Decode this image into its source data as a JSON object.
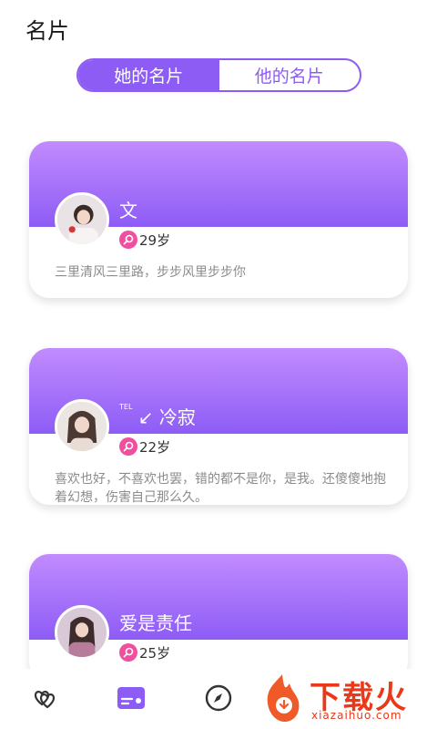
{
  "header": {
    "title": "名片"
  },
  "segments": {
    "left": "她的名片",
    "right": "他的名片"
  },
  "cards": [
    {
      "name": "文",
      "tel": "",
      "age": "29岁",
      "bio": "三里清风三里路，步步风里步步你"
    },
    {
      "name": "冷寂",
      "tel": "TEL",
      "age": "22岁",
      "bio": "喜欢也好，不喜欢也罢，错的都不是你，是我。还傻傻地抱着幻想，伤害自己那么久。"
    },
    {
      "name": "爱是责任",
      "tel": "",
      "age": "25岁",
      "bio": ""
    }
  ],
  "tabbar": {
    "items": [
      "heart-tab",
      "card-tab",
      "discover-tab"
    ]
  },
  "watermark": {
    "text": "下载火",
    "sub": "xiazaihuo.com"
  },
  "colors": {
    "accent": "#8d5cf5",
    "female": "#f04fa0"
  }
}
